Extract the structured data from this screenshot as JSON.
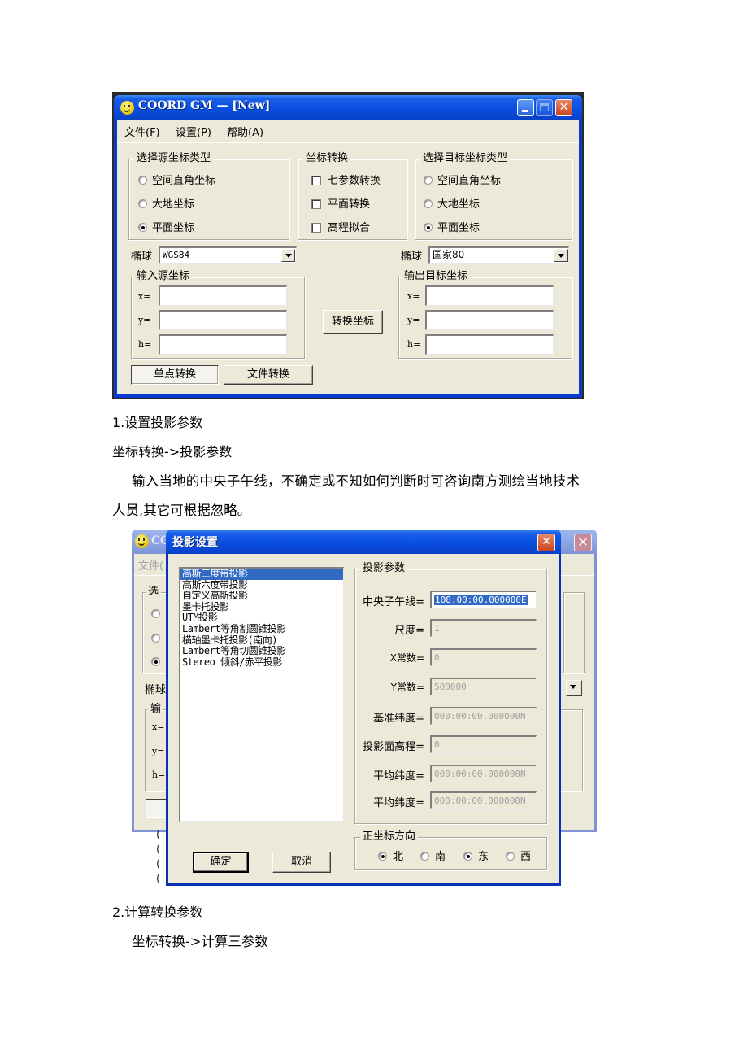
{
  "main_window": {
    "title": "COORD GM — [New]",
    "menu": [
      "文件(F)",
      "设置(P)",
      "帮助(A)"
    ],
    "source_type": {
      "legend": "选择源坐标类型",
      "options": [
        "空间直角坐标",
        "大地坐标",
        "平面坐标"
      ],
      "selected": "平面坐标"
    },
    "conversion": {
      "legend": "坐标转换",
      "options": [
        "七参数转换",
        "平面转换",
        "高程拟合"
      ],
      "checked": []
    },
    "target_type": {
      "legend": "选择目标坐标类型",
      "options": [
        "空间直角坐标",
        "大地坐标",
        "平面坐标"
      ],
      "selected": "平面坐标"
    },
    "src_ellipsoid_label": "椭球",
    "src_ellipsoid_value": "WGS84",
    "dst_ellipsoid_label": "椭球",
    "dst_ellipsoid_value": "国家80",
    "input_group": {
      "legend": "输入源坐标",
      "labels": [
        "x=",
        "y=",
        "h="
      ],
      "values": [
        "",
        "",
        ""
      ]
    },
    "output_group": {
      "legend": "输出目标坐标",
      "labels": [
        "x=",
        "y=",
        "h="
      ],
      "values": [
        "",
        "",
        ""
      ]
    },
    "convert_button": "转换坐标",
    "tabs": [
      "单点转换",
      "文件转换"
    ],
    "active_tab": "单点转换"
  },
  "doc": {
    "heading1": "1.设置投影参数",
    "path1": "坐标转换->投影参数",
    "para1_line1": "输入当地的中央子午线，不确定或不知如何判断时可咨询南方测绘当地技术",
    "para1_line2": "人员,其它可根据忽略。",
    "heading2": "2.计算转换参数",
    "path2": "坐标转换->计算三参数"
  },
  "background_window": {
    "title_fragment": "CO",
    "menu_fragment": "文件(",
    "group_fragment": "选",
    "ellipsoid_fragment": "椭球",
    "input_fragment": "输",
    "labels": [
      "x=",
      "y=",
      "h="
    ]
  },
  "projection_dialog": {
    "title": "投影设置",
    "projections": [
      "高斯三度带投影",
      "高斯六度带投影",
      "自定义高斯投影",
      "墨卡托投影",
      "UTM投影",
      "Lambert等角割圆锥投影",
      "横轴墨卡托投影(南向)",
      "Lambert等角切圆锥投影",
      "Stereo 倾斜/赤平投影"
    ],
    "selected_projection": "高斯三度带投影",
    "params_legend": "投影参数",
    "params": [
      {
        "label": "中央子午线=",
        "value": "108:00:00.000000E",
        "enabled": true,
        "selected": true
      },
      {
        "label": "尺度=",
        "value": "1",
        "enabled": false
      },
      {
        "label": "X常数=",
        "value": "0",
        "enabled": false
      },
      {
        "label": "Y常数=",
        "value": "500000",
        "enabled": false
      },
      {
        "label": "基准纬度=",
        "value": "000:00:00.000000N",
        "enabled": false
      },
      {
        "label": "投影面高程=",
        "value": "0",
        "enabled": false
      },
      {
        "label": "平均纬度=",
        "value": "000:00:00.000000N",
        "enabled": false
      },
      {
        "label": "平均纬度=",
        "value": "000:00:00.000000N",
        "enabled": false
      }
    ],
    "direction_legend": "正坐标方向",
    "directions": [
      "北",
      "南",
      "东",
      "西"
    ],
    "selected_directions": [
      "北",
      "东"
    ],
    "ok_button": "确定",
    "cancel_button": "取消"
  }
}
